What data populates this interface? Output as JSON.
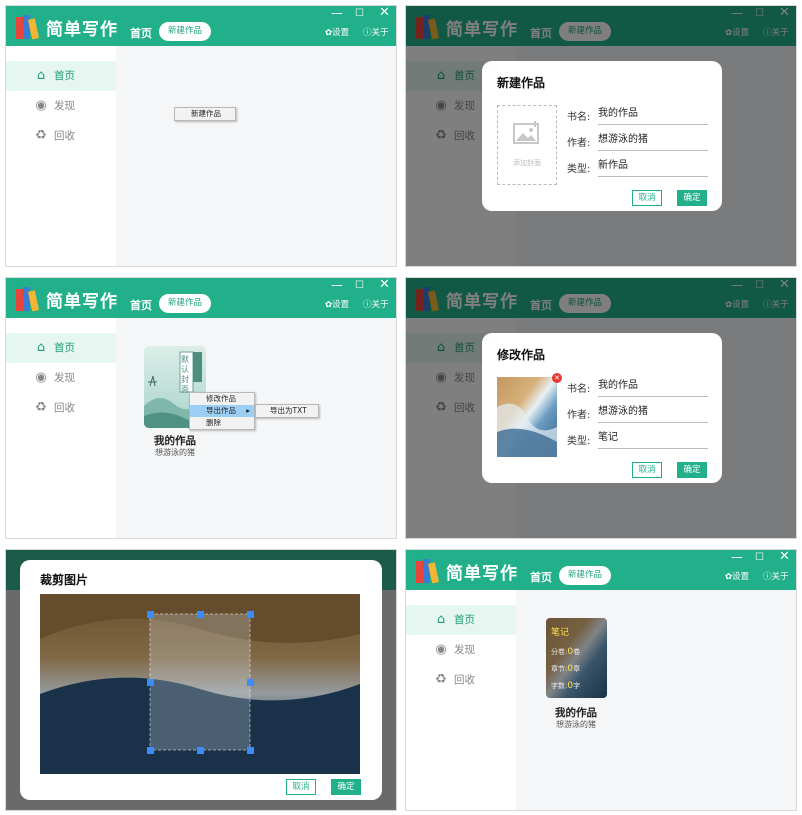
{
  "app": {
    "logo_text": "简单写作",
    "nav_home": "首页",
    "nav_new": "新建作品",
    "settings": "设置",
    "about": "关于",
    "min": "—",
    "max": "☐",
    "close": "✕"
  },
  "sidebar": {
    "items": [
      {
        "label": "首页",
        "icon": "home-icon"
      },
      {
        "label": "发现",
        "icon": "eye-icon"
      },
      {
        "label": "回收",
        "icon": "recycle-icon"
      }
    ]
  },
  "p1": {
    "context_button": "新建作品"
  },
  "new_dialog": {
    "title": "新建作品",
    "cover_hint": "添加封面",
    "name_label": "书名:",
    "name_value": "我的作品",
    "author_label": "作者:",
    "author_value": "想游泳的猪",
    "type_label": "类型:",
    "type_value": "新作品",
    "cancel": "取消",
    "ok": "确定"
  },
  "p3": {
    "book_title": "我的作品",
    "book_author": "想游泳的猪",
    "cover_text": "默认封面",
    "menu": [
      "修改作品",
      "导出作品",
      "删除"
    ],
    "submenu": "导出为TXT"
  },
  "edit_dialog": {
    "title": "修改作品",
    "name_label": "书名:",
    "name_value": "我的作品",
    "author_label": "作者:",
    "author_value": "想游泳的猪",
    "type_label": "类型:",
    "type_value": "笔记",
    "cancel": "取消",
    "ok": "确定"
  },
  "crop_dialog": {
    "title": "裁剪图片",
    "cancel": "取消",
    "ok": "确定"
  },
  "p6": {
    "book_title": "我的作品",
    "book_author": "想游泳的猪",
    "card_type": "笔记",
    "stats": [
      {
        "label": "分卷:",
        "value": "0",
        "unit": "卷"
      },
      {
        "label": "章节:",
        "value": "0",
        "unit": "章"
      },
      {
        "label": "字数:",
        "value": "0",
        "unit": "字"
      }
    ]
  },
  "colors": {
    "primary": "#22b08a",
    "sidebar_active": "#e6f6f1",
    "card_highlight": "#ffe14d"
  }
}
